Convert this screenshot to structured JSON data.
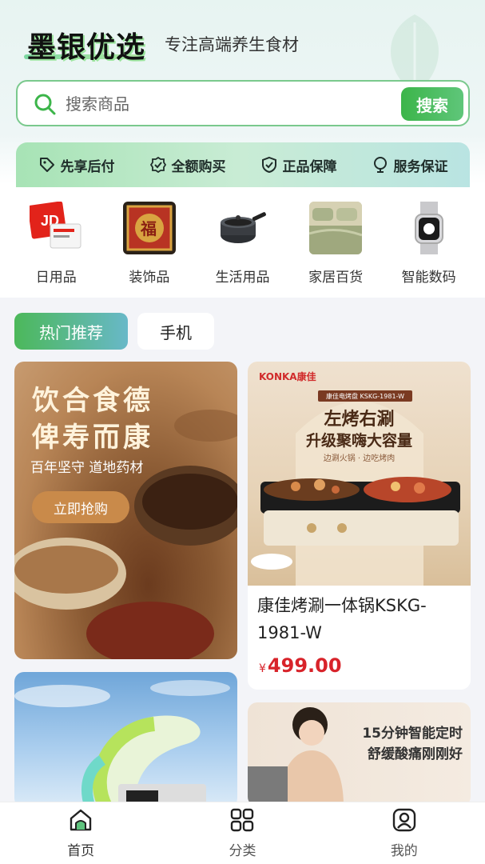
{
  "header": {
    "logo": "墨银优选",
    "slogan": "专注高端养生食材"
  },
  "search": {
    "placeholder": "搜索商品",
    "button": "搜索"
  },
  "guarantees": [
    {
      "label": "先享后付",
      "icon": "tag-icon"
    },
    {
      "label": "全额购买",
      "icon": "check-badge-icon"
    },
    {
      "label": "正品保障",
      "icon": "shield-icon"
    },
    {
      "label": "服务保证",
      "icon": "service-icon"
    }
  ],
  "categories": [
    {
      "label": "日用品",
      "icon": "jd-card-image"
    },
    {
      "label": "装饰品",
      "icon": "decoration-image"
    },
    {
      "label": "生活用品",
      "icon": "pan-image"
    },
    {
      "label": "家居百货",
      "icon": "bedding-image"
    },
    {
      "label": "智能数码",
      "icon": "smartwatch-image"
    }
  ],
  "tabs": [
    {
      "label": "热门推荐",
      "active": true
    },
    {
      "label": "手机",
      "active": false
    }
  ],
  "products": {
    "card1": {
      "poster_title_line1": "饮合食德",
      "poster_title_line2": "俾寿而康",
      "poster_subtitle": "百年坚守 道地药材",
      "poster_button": "立即抢购"
    },
    "card2": {
      "brand": "KONKA康佳",
      "model_tag": "康佳电烤盘 KSKG-1981-W",
      "headline1": "左烤右涮",
      "headline2": "升级聚嗨大容量",
      "tagline": "边涮火锅 · 边吃烤肉",
      "title": "康佳烤涮一体锅KSKG-1981-W",
      "currency": "¥",
      "price": "499.00"
    },
    "card4": {
      "line1": "15分钟智能定时",
      "line2": "舒缓酸痛刚刚好"
    }
  },
  "bottom_nav": [
    {
      "label": "首页",
      "icon": "home-icon",
      "active": true
    },
    {
      "label": "分类",
      "icon": "grid-icon",
      "active": false
    },
    {
      "label": "我的",
      "icon": "user-icon",
      "active": false
    }
  ],
  "colors": {
    "accent": "#3cb54a",
    "price": "#d8232a"
  }
}
